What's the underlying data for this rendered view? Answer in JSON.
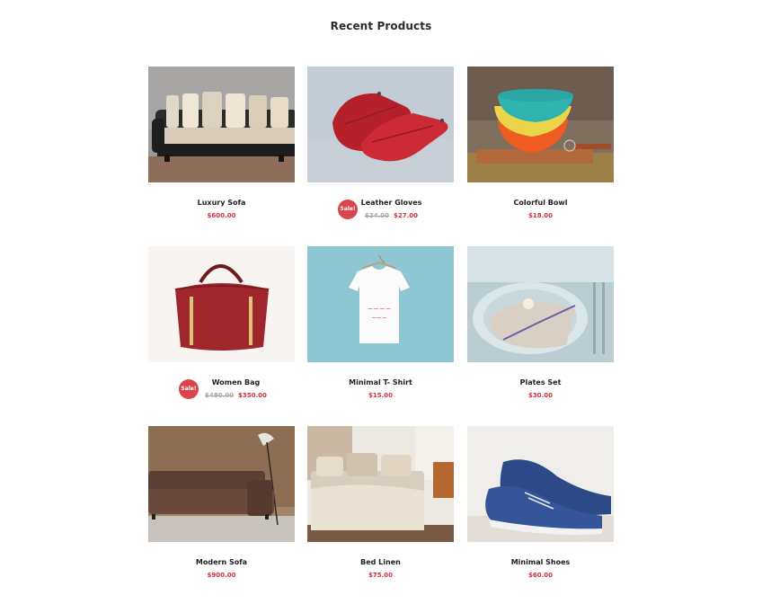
{
  "section": {
    "title": "Recent Products"
  },
  "badge": {
    "sale_label": "Sale!"
  },
  "products": [
    {
      "name": "Luxury Sofa",
      "price": "$600.00",
      "old_price": "",
      "on_sale": false,
      "icon": "sofa-image"
    },
    {
      "name": "Leather Gloves",
      "price": "$27.00",
      "old_price": "$34.00",
      "on_sale": true,
      "icon": "gloves-image"
    },
    {
      "name": "Colorful Bowl",
      "price": "$18.00",
      "old_price": "",
      "on_sale": false,
      "icon": "bowl-image"
    },
    {
      "name": "Women Bag",
      "price": "$350.00",
      "old_price": "$480.00",
      "on_sale": true,
      "icon": "bag-image"
    },
    {
      "name": "Minimal T- Shirt",
      "price": "$15.00",
      "old_price": "",
      "on_sale": false,
      "icon": "tshirt-image"
    },
    {
      "name": "Plates Set",
      "price": "$30.00",
      "old_price": "",
      "on_sale": false,
      "icon": "plates-image"
    },
    {
      "name": "Modern Sofa",
      "price": "$900.00",
      "old_price": "",
      "on_sale": false,
      "icon": "modern-sofa-image"
    },
    {
      "name": "Bed Linen",
      "price": "$75.00",
      "old_price": "",
      "on_sale": false,
      "icon": "bed-image"
    },
    {
      "name": "Minimal Shoes",
      "price": "$60.00",
      "old_price": "",
      "on_sale": false,
      "icon": "shoes-image"
    }
  ],
  "colors": {
    "accent": "#d1313d",
    "sale_badge": "#d9454c",
    "old_price": "#a8a8a8"
  }
}
